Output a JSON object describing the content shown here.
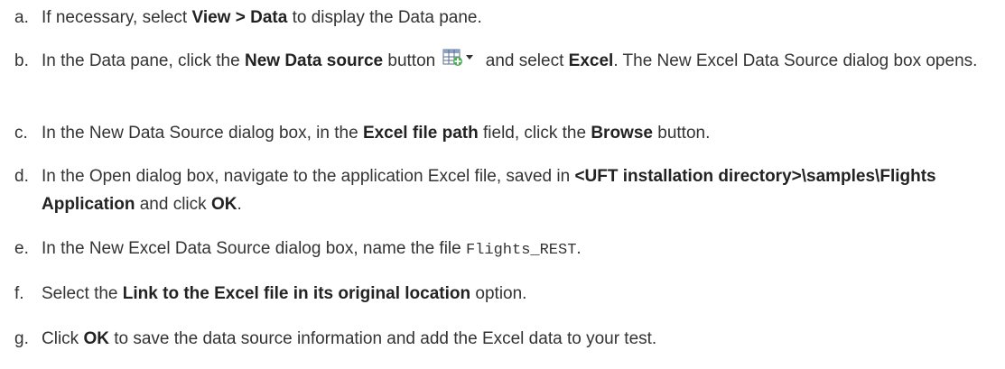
{
  "steps": [
    {
      "marker": "a.",
      "parts": [
        {
          "t": "If necessary, select "
        },
        {
          "b": "View > Data"
        },
        {
          "t": " to display the Data pane."
        }
      ]
    },
    {
      "marker": "b.",
      "parts": [
        {
          "t": "In the Data pane, click the "
        },
        {
          "b": "New Data source"
        },
        {
          "t": " button "
        },
        {
          "icon": "new-data-source-icon"
        },
        {
          "t": " and select "
        },
        {
          "b": "Excel"
        },
        {
          "t": ". The New Excel Data Source dialog box opens."
        }
      ]
    },
    {
      "marker": "c.",
      "parts": [
        {
          "t": "In the New Data Source dialog box, in the "
        },
        {
          "b": "Excel file path"
        },
        {
          "t": " field, click the "
        },
        {
          "b": "Browse"
        },
        {
          "t": " button."
        }
      ]
    },
    {
      "marker": "d.",
      "parts": [
        {
          "t": "In the Open dialog box, navigate to the application Excel file, saved in "
        },
        {
          "b": "<UFT installation directory>\\samples\\Flights Application"
        },
        {
          "t": " and click "
        },
        {
          "b": "OK"
        },
        {
          "t": "."
        }
      ]
    },
    {
      "marker": "e.",
      "parts": [
        {
          "t": "In the New Excel Data Source dialog box, name the file "
        },
        {
          "code": "Flights_REST"
        },
        {
          "t": "."
        }
      ]
    },
    {
      "marker": "f.",
      "parts": [
        {
          "t": "Select the "
        },
        {
          "b": "Link to the Excel file in its original location"
        },
        {
          "t": " option."
        }
      ]
    },
    {
      "marker": "g.",
      "parts": [
        {
          "t": "Click "
        },
        {
          "b": "OK"
        },
        {
          "t": " to save the data source information and add the Excel data to your test."
        }
      ]
    }
  ]
}
